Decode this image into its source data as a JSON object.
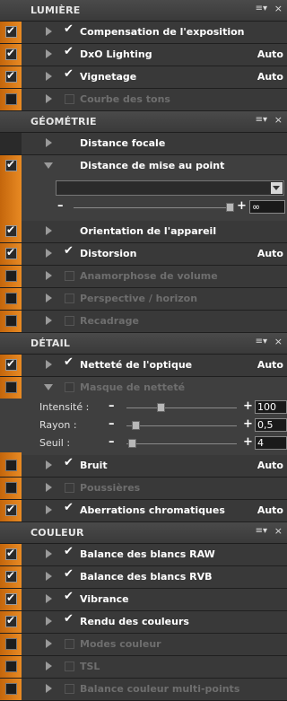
{
  "colors": {
    "accent": "#e07b1a",
    "panel": "#393939",
    "header": "#444444",
    "disabled_text": "#6e6e6e"
  },
  "icons": {
    "menu": "≡▾",
    "close": "×",
    "expand": "arrow-right-icon",
    "collapse": "arrow-down-icon"
  },
  "sections": {
    "lumiere": {
      "title": "LUMIÈRE",
      "rows": [
        {
          "label": "Compensation de l'exposition",
          "value": ""
        },
        {
          "label": "DxO Lighting",
          "value": "Auto"
        },
        {
          "label": "Vignetage",
          "value": "Auto"
        },
        {
          "label": "Courbe des tons",
          "value": ""
        }
      ]
    },
    "geometrie": {
      "title": "GÉOMÉTRIE",
      "rows": [
        {
          "label": "Distance focale",
          "value": ""
        },
        {
          "label": "Distance de mise au point",
          "value": ""
        },
        {
          "label": "Orientation de l'appareil",
          "value": ""
        },
        {
          "label": "Distorsion",
          "value": "Auto"
        },
        {
          "label": "Anamorphose de volume",
          "value": ""
        },
        {
          "label": "Perspective / horizon",
          "value": ""
        },
        {
          "label": "Recadrage",
          "value": ""
        }
      ],
      "focus_dropdown_value": "",
      "focus_slider": {
        "minus": "–",
        "plus": "+",
        "value": "∞"
      }
    },
    "detail": {
      "title": "DÉTAIL",
      "rows": [
        {
          "label": "Netteté de l'optique",
          "value": "Auto"
        },
        {
          "label": "Masque de netteté",
          "value": ""
        },
        {
          "label": "Bruit",
          "value": "Auto"
        },
        {
          "label": "Poussières",
          "value": ""
        },
        {
          "label": "Aberrations chromatiques",
          "value": "Auto"
        }
      ],
      "params": [
        {
          "label": "Intensité :",
          "value": "100",
          "level": 0.3
        },
        {
          "label": "Rayon :",
          "value": "0,5",
          "level": 0.05
        },
        {
          "label": "Seuil :",
          "value": "4",
          "level": 0.02
        }
      ]
    },
    "couleur": {
      "title": "COULEUR",
      "rows": [
        {
          "label": "Balance des blancs RAW",
          "value": ""
        },
        {
          "label": "Balance des blancs RVB",
          "value": ""
        },
        {
          "label": "Vibrance",
          "value": ""
        },
        {
          "label": "Rendu des couleurs",
          "value": ""
        },
        {
          "label": "Modes couleur",
          "value": ""
        },
        {
          "label": "TSL",
          "value": ""
        },
        {
          "label": "Balance couleur multi-points",
          "value": ""
        }
      ]
    }
  }
}
